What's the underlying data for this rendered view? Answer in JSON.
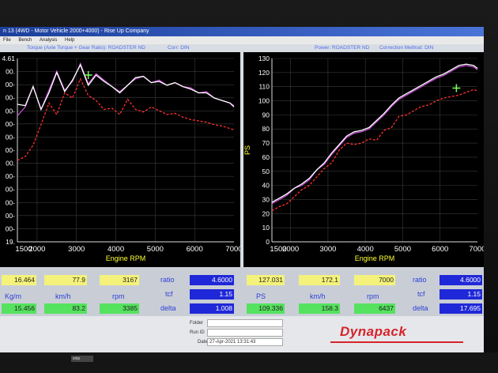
{
  "window": {
    "title": "n 13 (4WD - Motor Vehicle 2000+4000) - Rise Up Company",
    "menu": [
      "File",
      "Bench",
      "Analysis",
      "Help"
    ]
  },
  "left_panel": {
    "title_left": "Torque (Axle Torque + Gear Ratio): ROADSTER ND",
    "title_right": "Corr: DIN"
  },
  "right_panel": {
    "title_left": "Power: ROADSTER ND",
    "title_right": "Correction Method: DIN"
  },
  "colors": {
    "run1": "#c04bd0",
    "run2": "#ffffff",
    "run3": "#ff3030",
    "marker": "#7dff5a",
    "axis_text": "#ffffff",
    "xlabel": "#ffff33"
  },
  "chart_data": [
    {
      "type": "line",
      "xlabel": "Engine RPM",
      "ylabel": "",
      "xlim": [
        1500,
        7000
      ],
      "ylim": [
        4.61,
        19
      ],
      "x_ticks": [
        "1500",
        "2000",
        "3000",
        "4000",
        "5000",
        "6000",
        "7000"
      ],
      "y_ticks": [
        "19.",
        "00-",
        "00-",
        "00-",
        "00-",
        "00-",
        "00.",
        "00-",
        "00-",
        "00-",
        "00-",
        "00-",
        "00-",
        "00.",
        "4.61"
      ],
      "series": [
        {
          "x": [
            1500,
            1700,
            1900,
            2100,
            2300,
            2500,
            2700,
            2900,
            3100,
            3300,
            3500,
            3700,
            3900,
            4100,
            4300,
            4500,
            4700,
            4900,
            5100,
            5300,
            5500,
            5700,
            5900,
            6100,
            6300,
            6500,
            6700,
            6900,
            7000
          ],
          "y": [
            14.5,
            15.2,
            16.8,
            15.0,
            16.5,
            18.0,
            16.5,
            17.2,
            18.6,
            17.0,
            17.8,
            17.3,
            16.8,
            16.4,
            16.9,
            17.4,
            17.6,
            17.1,
            17.3,
            16.9,
            17.1,
            16.8,
            16.7,
            16.3,
            16.4,
            15.9,
            15.7,
            15.5,
            15.3
          ]
        },
        {
          "x": [
            1500,
            1700,
            1900,
            2100,
            2300,
            2500,
            2700,
            2900,
            3100,
            3300,
            3500,
            3700,
            3900,
            4100,
            4300,
            4500,
            4700,
            4900,
            5100,
            5300,
            5500,
            5700,
            5900,
            6100,
            6300,
            6500,
            6700,
            6900,
            7000
          ],
          "y": [
            15.4,
            15.3,
            16.8,
            15.0,
            16.3,
            17.9,
            16.4,
            17.3,
            18.5,
            16.9,
            17.7,
            17.2,
            16.8,
            16.3,
            16.9,
            17.5,
            17.6,
            17.1,
            17.2,
            16.9,
            17.1,
            16.8,
            16.6,
            16.3,
            16.3,
            15.9,
            15.7,
            15.5,
            15.2
          ]
        },
        {
          "x": [
            1500,
            1700,
            1900,
            2100,
            2300,
            2500,
            2700,
            2900,
            3100,
            3300,
            3500,
            3700,
            3900,
            4100,
            4300,
            4500,
            4700,
            4900,
            5100,
            5300,
            5500,
            5700,
            5900,
            6100,
            6300,
            6500,
            6700,
            6900,
            7000
          ],
          "y": [
            11.0,
            11.3,
            12.2,
            13.8,
            15.5,
            14.6,
            16.3,
            15.9,
            17.4,
            16.1,
            15.7,
            15.0,
            15.1,
            14.6,
            15.8,
            15.0,
            14.8,
            15.2,
            14.9,
            14.6,
            14.7,
            14.4,
            14.2,
            14.1,
            14.0,
            13.8,
            13.7,
            13.5,
            13.4
          ]
        }
      ]
    },
    {
      "type": "line",
      "xlabel": "Engine RPM",
      "ylabel": "PS",
      "xlim": [
        1500,
        7000
      ],
      "ylim": [
        0,
        130
      ],
      "x_ticks": [
        "1500",
        "2000",
        "3000",
        "4000",
        "5000",
        "6000",
        "7000"
      ],
      "y_ticks": [
        "0",
        "10",
        "20",
        "30",
        "40",
        "50",
        "60",
        "70",
        "80",
        "90",
        "100",
        "110",
        "120",
        "130"
      ],
      "series": [
        {
          "x": [
            1500,
            1700,
            1900,
            2100,
            2300,
            2500,
            2700,
            2900,
            3100,
            3300,
            3500,
            3700,
            3900,
            4100,
            4300,
            4500,
            4700,
            4900,
            5100,
            5300,
            5500,
            5700,
            5900,
            6100,
            6300,
            6500,
            6700,
            6900,
            7000
          ],
          "y": [
            27,
            30,
            33,
            38,
            40,
            44,
            51,
            55,
            62,
            68,
            74,
            77,
            78,
            80,
            85,
            90,
            96,
            101,
            104,
            107,
            110,
            113,
            116,
            118,
            121,
            124,
            125,
            124,
            122
          ]
        },
        {
          "x": [
            1500,
            1700,
            1900,
            2100,
            2300,
            2500,
            2700,
            2900,
            3100,
            3300,
            3500,
            3700,
            3900,
            4100,
            4300,
            4500,
            4700,
            4900,
            5100,
            5300,
            5500,
            5700,
            5900,
            6100,
            6300,
            6500,
            6700,
            6900,
            7000
          ],
          "y": [
            28,
            31,
            34,
            38,
            41,
            45,
            51,
            56,
            63,
            69,
            75,
            78,
            79,
            81,
            86,
            91,
            97,
            102,
            105,
            108,
            111,
            114,
            117,
            119,
            122,
            125,
            126,
            125,
            123
          ]
        },
        {
          "x": [
            1500,
            1700,
            1900,
            2100,
            2300,
            2500,
            2700,
            2900,
            3100,
            3300,
            3500,
            3700,
            3900,
            4100,
            4300,
            4500,
            4700,
            4900,
            5100,
            5300,
            5500,
            5700,
            5900,
            6100,
            6300,
            6500,
            6700,
            6900,
            7000
          ],
          "y": [
            22,
            25,
            27,
            32,
            37,
            40,
            46,
            52,
            56,
            65,
            70,
            69,
            70,
            73,
            72,
            79,
            81,
            89,
            90,
            93,
            96,
            97,
            100,
            102,
            103,
            104,
            106,
            108,
            107
          ]
        }
      ]
    }
  ],
  "readout_left": {
    "row1": [
      "16.464",
      "77.9",
      "3167"
    ],
    "units": [
      "Kg/m",
      "km/h",
      "rpm"
    ],
    "row2": [
      "15.456",
      "83.2",
      "3385"
    ],
    "labels": [
      "ratio",
      "tcf",
      "delta"
    ],
    "values": [
      "4.6000",
      "1.15",
      "1.008"
    ]
  },
  "readout_right": {
    "row1": [
      "127.031",
      "172.1",
      "7000"
    ],
    "units": [
      "PS",
      "km/h",
      "rpm"
    ],
    "row2": [
      "109.336",
      "158.3",
      "6437"
    ],
    "labels": [
      "ratio",
      "tcf",
      "delta"
    ],
    "values": [
      "4.6000",
      "1.15",
      "17.695"
    ]
  },
  "footer": {
    "folder_label": "Folder",
    "run_id_label": "Run ID",
    "date_label": "Date",
    "date_value": "27-Apr-2021 13:31:43",
    "logo": "Dynapack"
  },
  "taskbar": {
    "item": "snip"
  }
}
